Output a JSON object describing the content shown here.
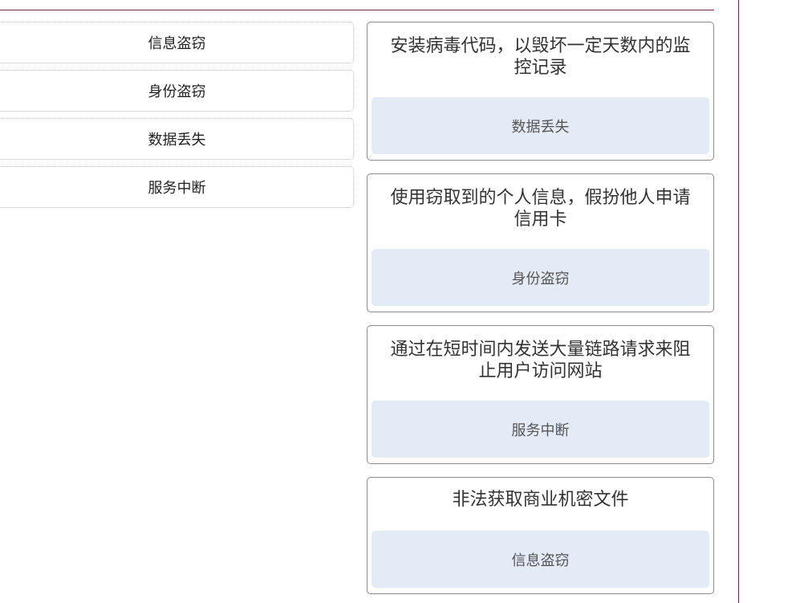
{
  "options": [
    {
      "label": "信息盗窃"
    },
    {
      "label": "身份盗窃"
    },
    {
      "label": "数据丢失"
    },
    {
      "label": "服务中断"
    }
  ],
  "targets": [
    {
      "description": "安装病毒代码，以毁坏一定天数内的监控记录",
      "placed": "数据丢失"
    },
    {
      "description": "使用窃取到的个人信息，假扮他人申请信用卡",
      "placed": "身份盗窃"
    },
    {
      "description": "通过在短时间内发送大量链路请求来阻止用户访问网站",
      "placed": "服务中断"
    },
    {
      "description": "非法获取商业机密文件",
      "placed": "信息盗窃"
    }
  ],
  "colors": {
    "accent_rule": "#6b2a4a",
    "drop_zone_bg": "#e3ebf7",
    "card_border": "#8c8c8c"
  }
}
